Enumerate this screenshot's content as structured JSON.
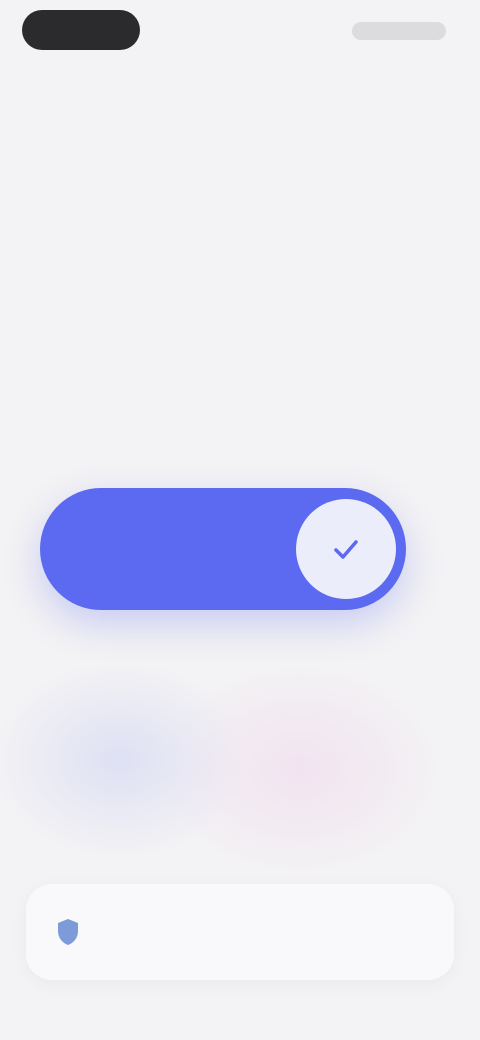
{
  "status_bar": {
    "time": "",
    "indicators": [
      "signal-icon",
      "wifi-icon",
      "battery-icon"
    ]
  },
  "headline": {
    "text": ""
  },
  "slider": {
    "label": "",
    "knob_icon": "check-icon",
    "color": "#5b6af0"
  },
  "info_card": {
    "icon": "shield-icon",
    "text": ""
  }
}
